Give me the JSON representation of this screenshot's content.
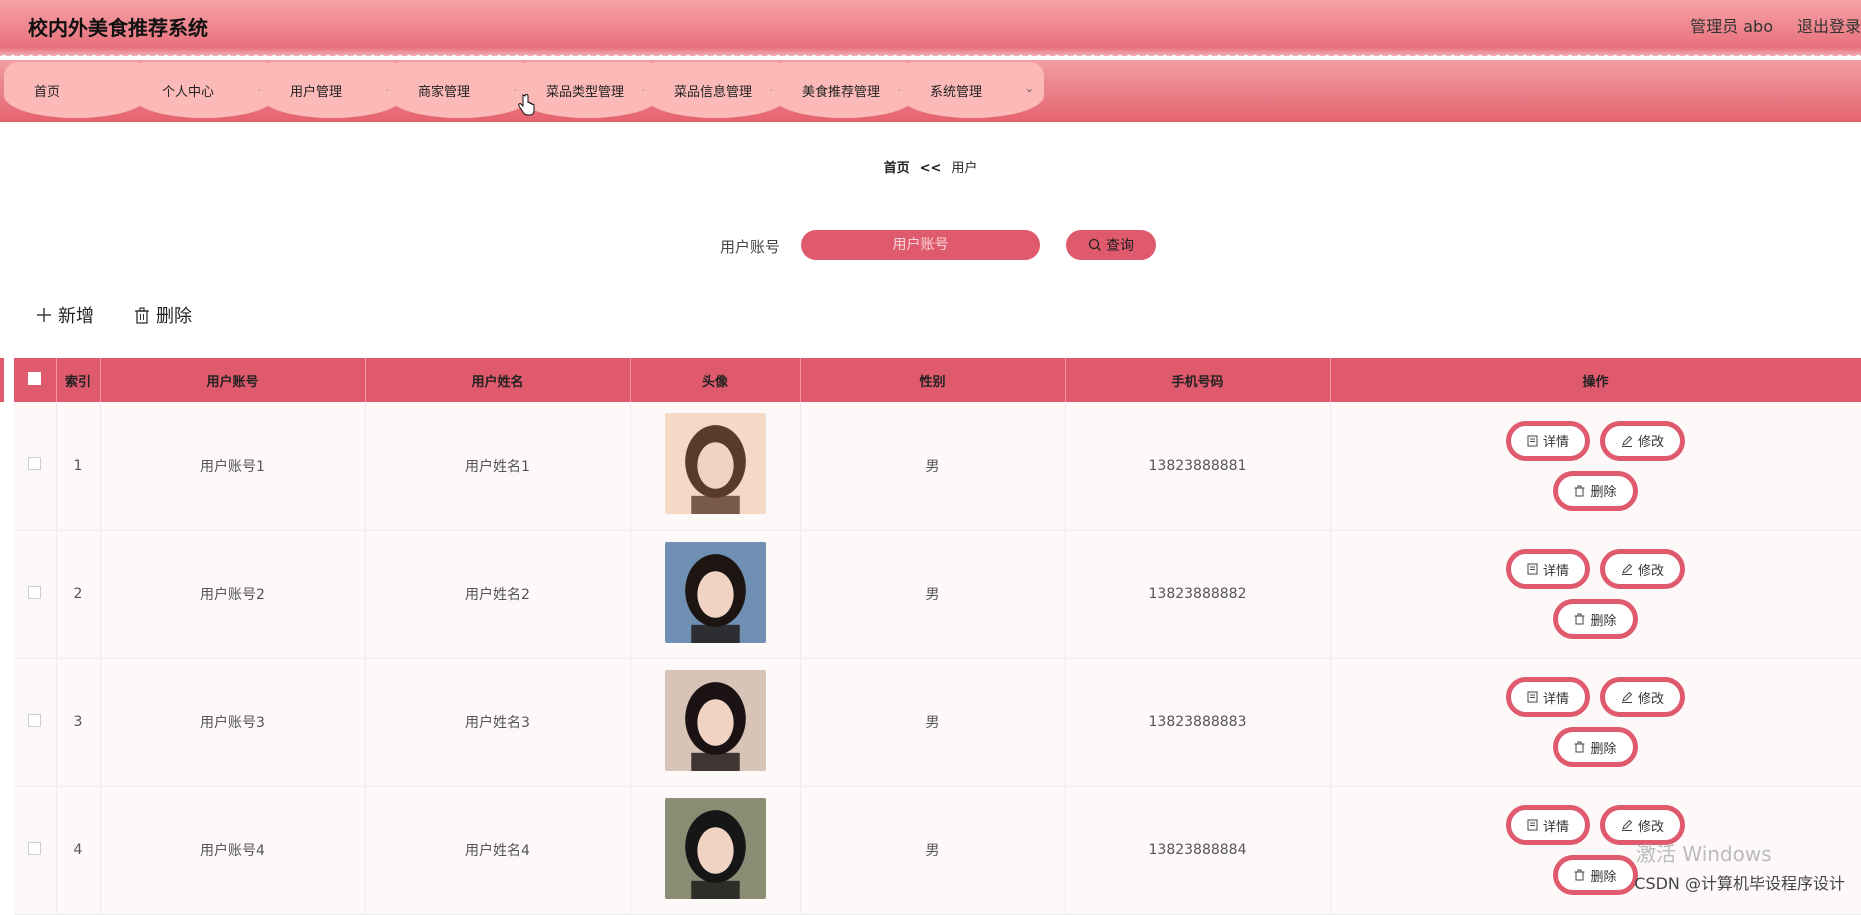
{
  "header": {
    "title": "校内外美食推荐系统",
    "user": "管理员 abo",
    "logout": "退出登录"
  },
  "nav": [
    {
      "label": "首页",
      "has_menu": false
    },
    {
      "label": "个人中心",
      "has_menu": true
    },
    {
      "label": "用户管理",
      "has_menu": true
    },
    {
      "label": "商家管理",
      "has_menu": true
    },
    {
      "label": "菜品类型管理",
      "has_menu": true
    },
    {
      "label": "菜品信息管理",
      "has_menu": true
    },
    {
      "label": "美食推荐管理",
      "has_menu": true
    },
    {
      "label": "系统管理",
      "has_menu": true
    }
  ],
  "breadcrumb": {
    "home": "首页",
    "sep": "<<",
    "current": "用户"
  },
  "search": {
    "label": "用户账号",
    "placeholder": "用户账号",
    "button": "查询"
  },
  "toolbar": {
    "add": "新增",
    "delete": "删除"
  },
  "table": {
    "headers": [
      "索引",
      "用户账号",
      "用户姓名",
      "头像",
      "性别",
      "手机号码",
      "操作"
    ],
    "rows": [
      {
        "index": "1",
        "account": "用户账号1",
        "name": "用户姓名1",
        "gender": "男",
        "phone": "13823888881"
      },
      {
        "index": "2",
        "account": "用户账号2",
        "name": "用户姓名2",
        "gender": "男",
        "phone": "13823888882"
      },
      {
        "index": "3",
        "account": "用户账号3",
        "name": "用户姓名3",
        "gender": "男",
        "phone": "13823888883"
      },
      {
        "index": "4",
        "account": "用户账号4",
        "name": "用户姓名4",
        "gender": "男",
        "phone": "13823888884"
      }
    ],
    "actions": {
      "detail": "详情",
      "edit": "修改",
      "delete": "删除"
    }
  },
  "overlay": {
    "windows": "激活 Windows",
    "credit": "CSDN @计算机毕设程序设计"
  },
  "colors": {
    "accent": "#e05a6d",
    "nav_tab": "#fbbab8",
    "header_top": "#f7a3a6"
  }
}
